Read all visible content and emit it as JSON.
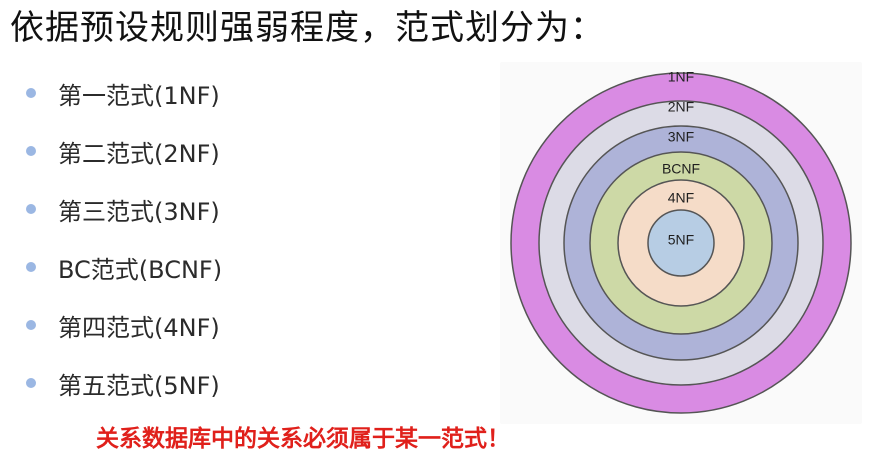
{
  "title": "依据预设规则强弱程度，范式划分为：",
  "bullets": [
    {
      "label": "第一范式(1NF)"
    },
    {
      "label": "第二范式(2NF)"
    },
    {
      "label": "第三范式(3NF)"
    },
    {
      "label": "BC范式(BCNF)"
    },
    {
      "label": "第四范式(4NF)"
    },
    {
      "label": "第五范式(5NF)"
    }
  ],
  "note": "关系数据库中的关系必须属于某一范式！",
  "colors": {
    "bullet_dot": "#9bb7e3",
    "note_text": "#e0201b",
    "ring_stroke": "#555555"
  },
  "diagram": {
    "rings": [
      {
        "label": "1NF",
        "fill": "#d98be3"
      },
      {
        "label": "2NF",
        "fill": "#dcdbe6"
      },
      {
        "label": "3NF",
        "fill": "#aeb3d8"
      },
      {
        "label": "BCNF",
        "fill": "#cdd9a6"
      },
      {
        "label": "4NF",
        "fill": "#f5dcc8"
      },
      {
        "label": "5NF",
        "fill": "#b7cde4"
      }
    ]
  }
}
